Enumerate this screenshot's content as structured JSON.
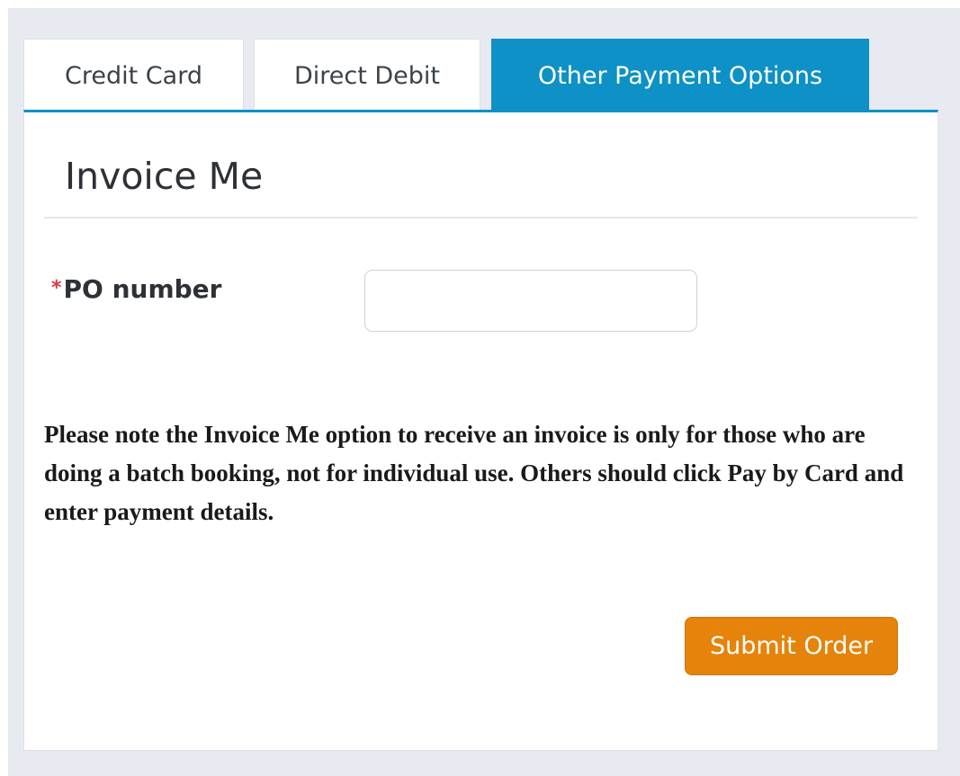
{
  "tabs": [
    {
      "label": "Credit Card",
      "active": false
    },
    {
      "label": "Direct Debit",
      "active": false
    },
    {
      "label": "Other Payment Options",
      "active": true
    }
  ],
  "section": {
    "title": "Invoice Me"
  },
  "po_field": {
    "required_marker": "*",
    "label": "PO number",
    "value": ""
  },
  "note": "Please note the Invoice Me option to receive an invoice is only for those who are doing a batch booking, not for individual use. Others should click Pay by Card and enter payment details.",
  "submit": {
    "label": "Submit Order"
  },
  "colors": {
    "accent": "#0d91c6",
    "submit": "#e5830a",
    "required": "#d9363e",
    "background": "#e7ebf1"
  }
}
